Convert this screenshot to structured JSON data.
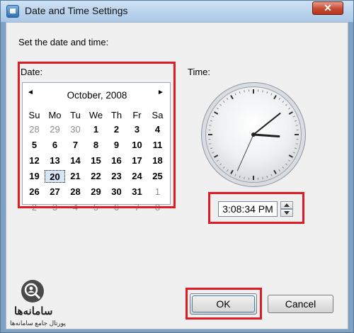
{
  "window": {
    "title": "Date and Time Settings",
    "close_glyph": "✕"
  },
  "intro": "Set the date and time:",
  "date_label": "Date:",
  "time_label": "Time:",
  "calendar": {
    "prev_arrow": "◄",
    "next_arrow": "►",
    "month_label": "October, 2008",
    "weekdays": [
      "Su",
      "Mo",
      "Tu",
      "We",
      "Th",
      "Fr",
      "Sa"
    ],
    "weeks": [
      [
        "28",
        "29",
        "30",
        "1",
        "2",
        "3",
        "4"
      ],
      [
        "5",
        "6",
        "7",
        "8",
        "9",
        "10",
        "11"
      ],
      [
        "12",
        "13",
        "14",
        "15",
        "16",
        "17",
        "18"
      ],
      [
        "19",
        "20",
        "21",
        "22",
        "23",
        "24",
        "25"
      ],
      [
        "26",
        "27",
        "28",
        "29",
        "30",
        "31",
        "1"
      ],
      [
        "2",
        "3",
        "4",
        "5",
        "6",
        "7",
        "8"
      ]
    ],
    "selected_day": "20"
  },
  "clock": {
    "hours": 3,
    "minutes": 8,
    "seconds": 34
  },
  "time_value": "3:08:34 PM",
  "buttons": {
    "ok": "OK",
    "cancel": "Cancel"
  },
  "watermark": {
    "title": "سامانه‌ها",
    "subtitle": "پورتال جامع سامانه‌ها"
  },
  "colors": {
    "highlight": "#e01b24",
    "title_bar": "#b9d3ee"
  }
}
